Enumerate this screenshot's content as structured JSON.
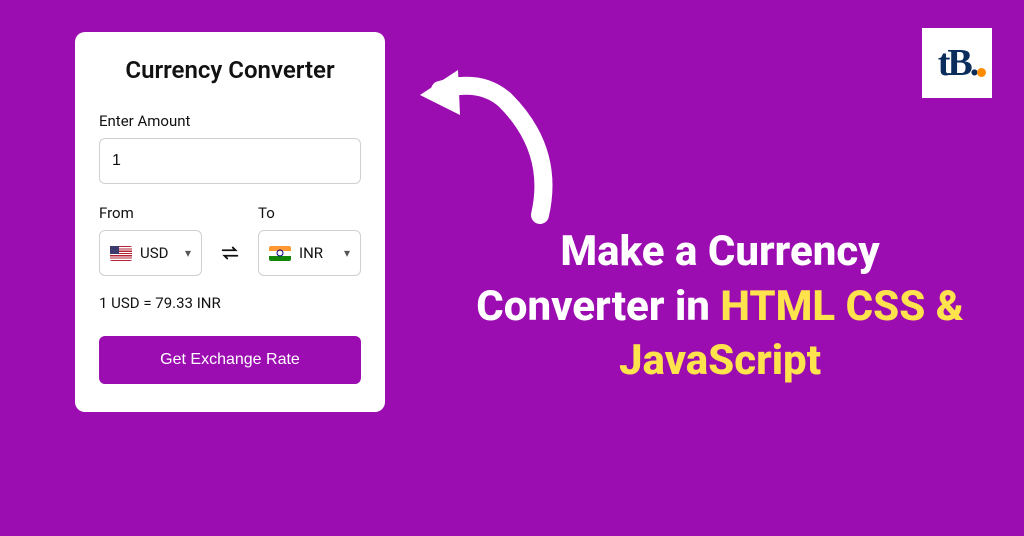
{
  "card": {
    "title": "Currency Converter",
    "amount_label": "Enter Amount",
    "amount_value": "1",
    "from_label": "From",
    "to_label": "To",
    "from_code": "USD",
    "to_code": "INR",
    "rate_text": "1 USD = 79.33 INR",
    "button_label": "Get Exchange Rate"
  },
  "headline": {
    "line1": "Make a Currency Converter in ",
    "highlight": "HTML CSS & JavaScript"
  },
  "logo": {
    "text": "tB"
  },
  "colors": {
    "background": "#9b0db0",
    "accent": "#9b0db0",
    "highlight": "#ffe34d"
  }
}
